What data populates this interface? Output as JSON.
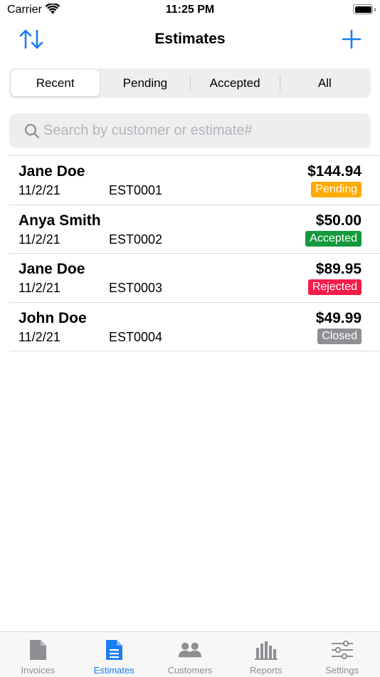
{
  "status_bar": {
    "carrier": "Carrier",
    "time": "11:25 PM"
  },
  "nav": {
    "title": "Estimates",
    "left_icon": "sort-arrows-icon",
    "right_icon": "plus-icon",
    "accent_color": "#1a7cf3"
  },
  "segments": {
    "items": [
      {
        "label": "Recent",
        "active": true
      },
      {
        "label": "Pending",
        "active": false
      },
      {
        "label": "Accepted",
        "active": false
      },
      {
        "label": "All",
        "active": false
      }
    ]
  },
  "search": {
    "placeholder": "Search by customer or estimate#",
    "value": ""
  },
  "estimates": [
    {
      "customer": "Jane Doe",
      "date": "11/2/21",
      "number": "EST0001",
      "amount": "$144.94",
      "status": "Pending",
      "status_color": "#ffaa00"
    },
    {
      "customer": "Anya Smith",
      "date": "11/2/21",
      "number": "EST0002",
      "amount": "$50.00",
      "status": "Accepted",
      "status_color": "#14993d"
    },
    {
      "customer": "Jane Doe",
      "date": "11/2/21",
      "number": "EST0003",
      "amount": "$89.95",
      "status": "Rejected",
      "status_color": "#f51d4a"
    },
    {
      "customer": "John Doe",
      "date": "11/2/21",
      "number": "EST0004",
      "amount": "$49.99",
      "status": "Closed",
      "status_color": "#8e8e93"
    }
  ],
  "tab_bar": {
    "items": [
      {
        "label": "Invoices",
        "icon": "document-icon",
        "active": false
      },
      {
        "label": "Estimates",
        "icon": "document-lines-icon",
        "active": true
      },
      {
        "label": "Customers",
        "icon": "people-icon",
        "active": false
      },
      {
        "label": "Reports",
        "icon": "bar-chart-icon",
        "active": false
      },
      {
        "label": "Settings",
        "icon": "sliders-icon",
        "active": false
      }
    ]
  }
}
